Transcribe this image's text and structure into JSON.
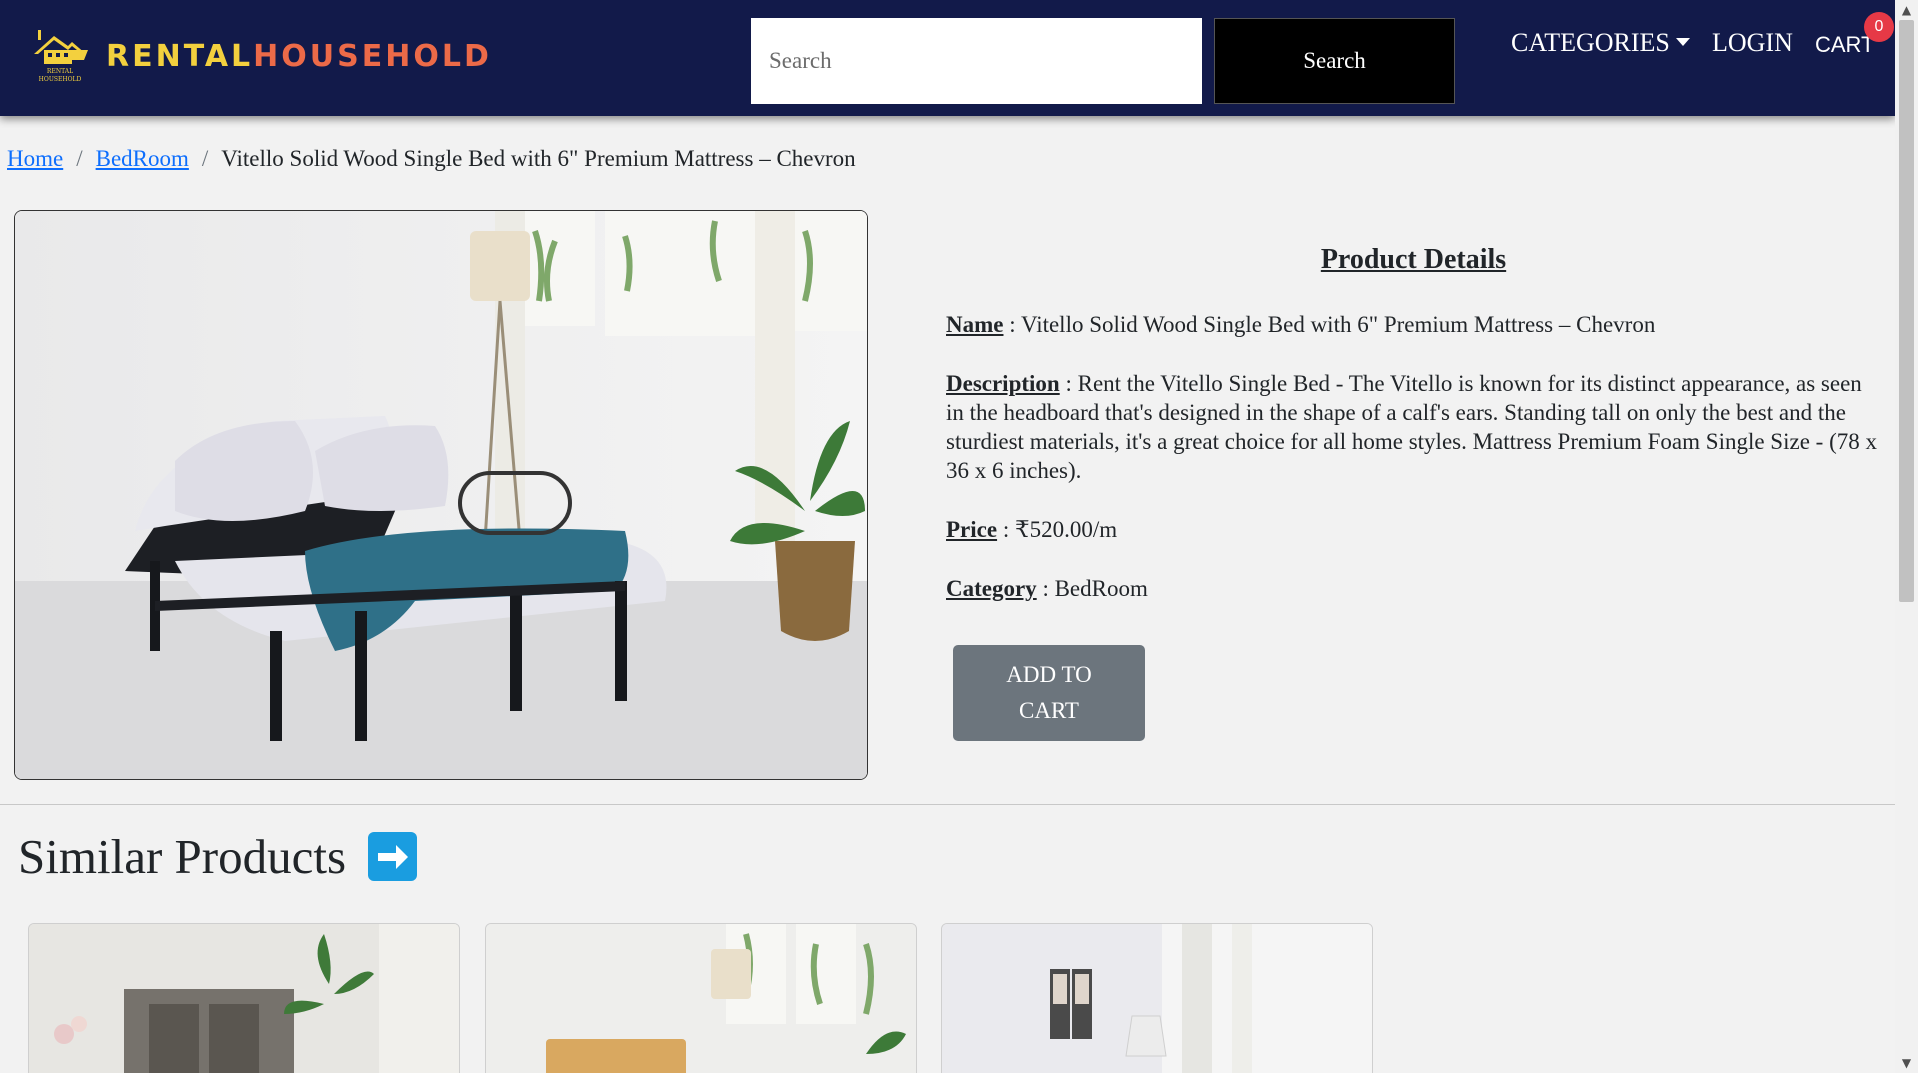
{
  "brand": {
    "part1": "RENTAL",
    "part2": "HOUSEHOLD",
    "emblem_text_1": "RENTAL",
    "emblem_text_2": "HOUSEHOLD"
  },
  "header": {
    "search_placeholder": "Search",
    "search_button": "Search",
    "categories": "CATEGORIES",
    "login": "LOGIN",
    "cart": "CART",
    "cart_count": "0"
  },
  "breadcrumb": {
    "home": "Home",
    "category": "BedRoom",
    "current": "Vitello Solid Wood Single Bed with 6\" Premium Mattress – Chevron"
  },
  "product": {
    "section_title": "Product Details",
    "name_label": "Name",
    "name": "Vitello Solid Wood Single Bed with 6\" Premium Mattress – Chevron",
    "description_label": "Description",
    "description": "Rent the Vitello Single Bed - The Vitello is known for its distinct appearance, as seen in the headboard that's designed in the shape of a calf's ears. Standing tall on only the best and the sturdiest materials, it's a great choice for all home styles. Mattress Premium Foam Single Size - (78 x 36 x 6 inches).",
    "price_label": "Price",
    "price": "₹520.00/m",
    "category_label": "Category",
    "category": "BedRoom",
    "add_to_cart_line1": "ADD TO",
    "add_to_cart_line2": "CART"
  },
  "similar": {
    "title": "Similar Products"
  },
  "icons": {
    "arrow": "right-arrow-icon",
    "caret": "caret-down-icon",
    "logo": "house-logo-icon"
  },
  "colors": {
    "navbar": "#121a4a",
    "brand_yellow": "#f3d03e",
    "brand_orange": "#ec6a48",
    "badge": "#e63946",
    "button_gray": "#6c757d",
    "link": "#0d6efd",
    "arrow_blue": "#1a9de0"
  }
}
